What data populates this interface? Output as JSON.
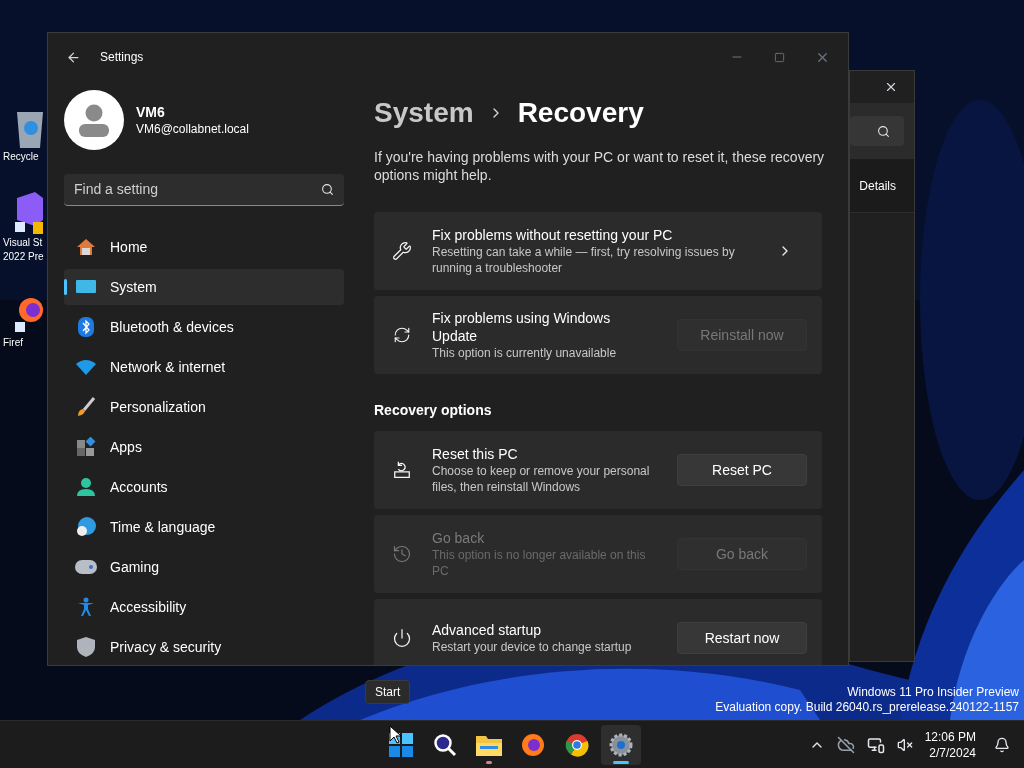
{
  "desktop": {
    "icons": [
      {
        "lines": [
          "Recycle"
        ]
      },
      {
        "lines": [
          "Visual St",
          "2022 Pre"
        ]
      },
      {
        "lines": [
          "Firef"
        ]
      }
    ],
    "watermark": [
      "Windows 11 Pro Insider Preview",
      "Evaluation copy. Build 26040.rs_prerelease.240122-1157"
    ]
  },
  "background_window": {
    "tab": "Details"
  },
  "settings": {
    "title": "Settings",
    "user": {
      "name": "VM6",
      "email": "VM6@collabnet.local"
    },
    "search": {
      "placeholder": "Find a setting"
    },
    "nav": [
      {
        "label": "Home",
        "selected": false
      },
      {
        "label": "System",
        "selected": true
      },
      {
        "label": "Bluetooth & devices",
        "selected": false
      },
      {
        "label": "Network & internet",
        "selected": false
      },
      {
        "label": "Personalization",
        "selected": false
      },
      {
        "label": "Apps",
        "selected": false
      },
      {
        "label": "Accounts",
        "selected": false
      },
      {
        "label": "Time & language",
        "selected": false
      },
      {
        "label": "Gaming",
        "selected": false
      },
      {
        "label": "Accessibility",
        "selected": false
      },
      {
        "label": "Privacy & security",
        "selected": false
      }
    ],
    "breadcrumb": {
      "parent": "System",
      "current": "Recovery"
    },
    "intro": "If you're having problems with your PC or want to reset it, these recovery options might help.",
    "groups": [
      {
        "cards": [
          {
            "title": "Fix problems without resetting your PC",
            "description": "Resetting can take a while — first, try resolving issues by running a troubleshooter",
            "disabled": false,
            "action": {
              "kind": "chevron"
            }
          },
          {
            "title": "Fix problems using Windows Update",
            "description": "This option is currently unavailable",
            "disabled": false,
            "action": {
              "kind": "button",
              "label": "Reinstall now",
              "disabled": true
            }
          }
        ]
      },
      {
        "heading": "Recovery options",
        "cards": [
          {
            "title": "Reset this PC",
            "description": "Choose to keep or remove your personal files, then reinstall Windows",
            "disabled": false,
            "action": {
              "kind": "button",
              "label": "Reset PC",
              "disabled": false
            }
          },
          {
            "title": "Go back",
            "description": "This option is no longer available on this PC",
            "disabled": true,
            "action": {
              "kind": "button",
              "label": "Go back",
              "disabled": true
            }
          },
          {
            "title": "Advanced startup",
            "description": "Restart your device to change startup",
            "disabled": false,
            "action": {
              "kind": "button",
              "label": "Restart now",
              "disabled": false
            }
          }
        ]
      }
    ]
  },
  "taskbar": {
    "tooltip": "Start",
    "apps": [
      {
        "running": false,
        "selected": false
      },
      {
        "running": false,
        "selected": false
      },
      {
        "running": true,
        "selected": false
      },
      {
        "running": false,
        "selected": false
      },
      {
        "running": false,
        "selected": false
      },
      {
        "running": true,
        "selected": true
      }
    ],
    "clock": {
      "time": "12:06 PM",
      "date": "2/7/2024"
    }
  }
}
